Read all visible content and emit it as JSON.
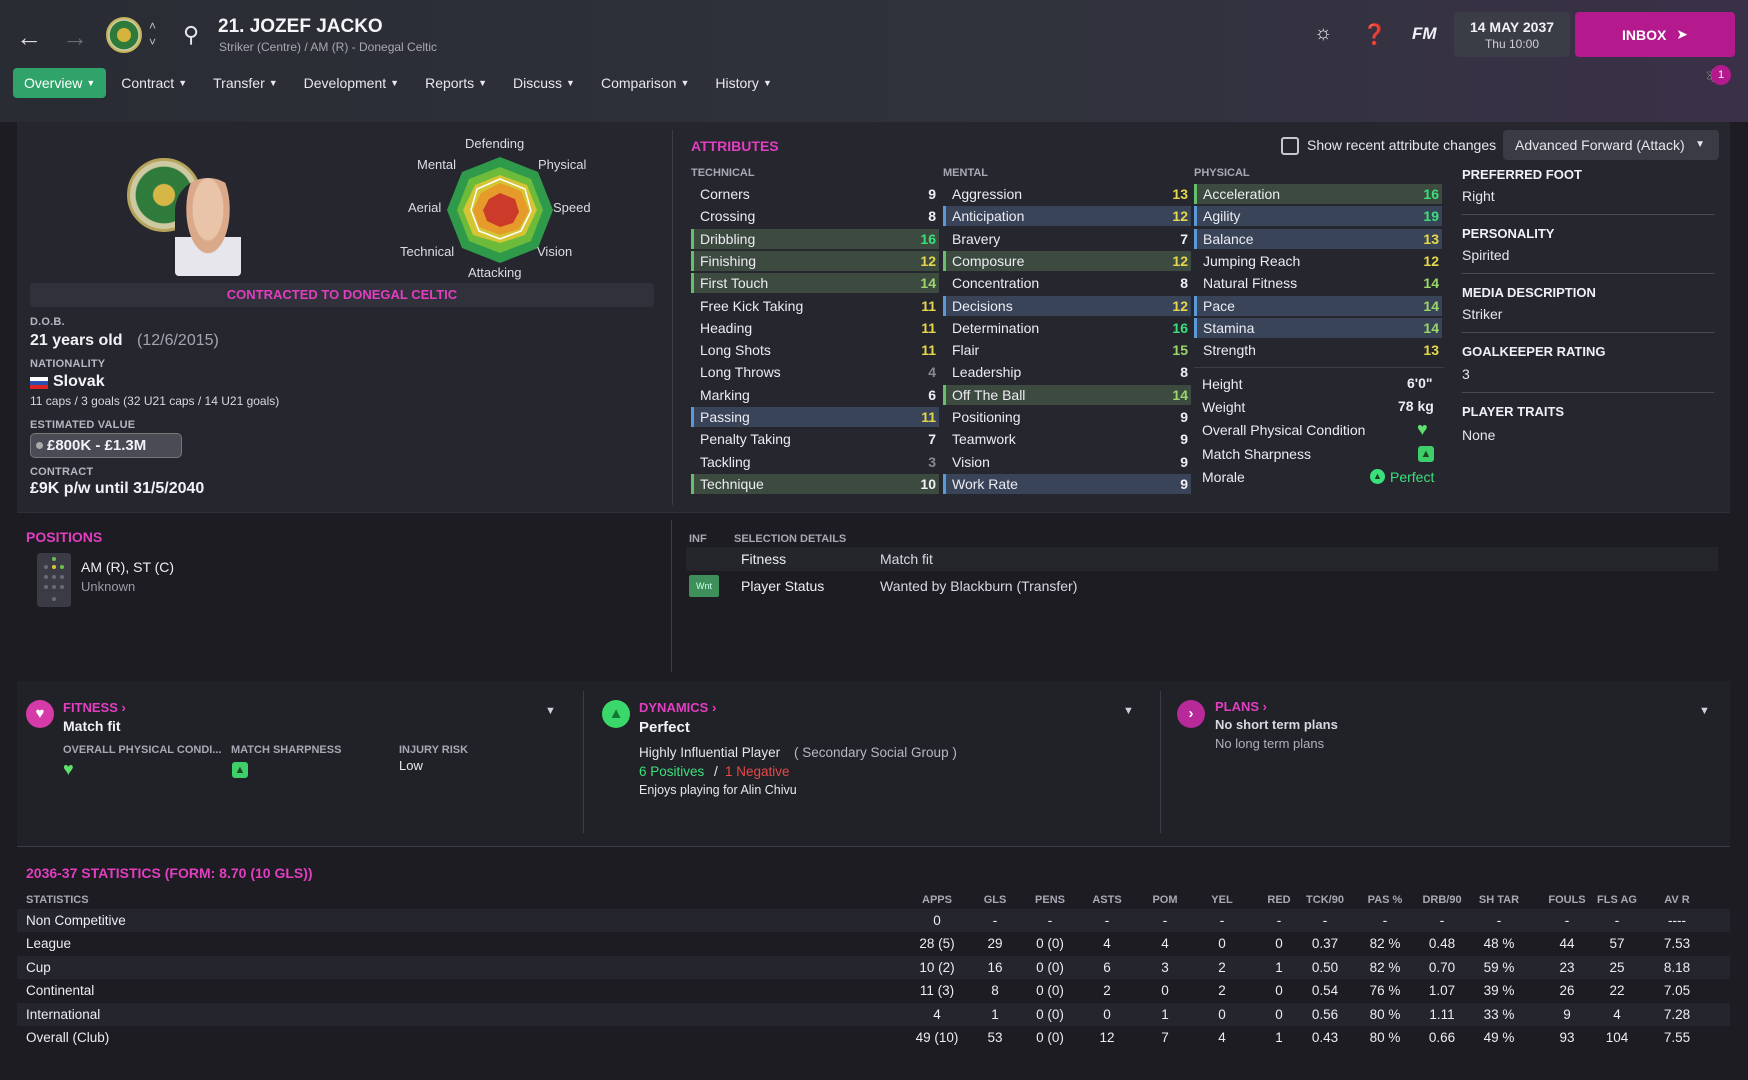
{
  "header": {
    "player_title": "21. JOZEF JACKO",
    "player_subtitle": "Striker (Centre) / AM (R) - Donegal Celtic",
    "fm_label": "FM",
    "date": "14 MAY 2037",
    "time": "Thu 10:00",
    "inbox_label": "INBOX",
    "notification_count": "1"
  },
  "menu": [
    {
      "label": "Overview"
    },
    {
      "label": "Contract"
    },
    {
      "label": "Transfer"
    },
    {
      "label": "Development"
    },
    {
      "label": "Reports"
    },
    {
      "label": "Discuss"
    },
    {
      "label": "Comparison"
    },
    {
      "label": "History"
    }
  ],
  "radar": {
    "labels": [
      "Defending",
      "Physical",
      "Speed",
      "Vision",
      "Attacking",
      "Technical",
      "Aerial",
      "Mental"
    ]
  },
  "profile": {
    "contracted": "CONTRACTED TO DONEGAL CELTIC",
    "dob_label": "D.O.B.",
    "age": "21 years old",
    "dob": "(12/6/2015)",
    "nationality_label": "NATIONALITY",
    "nationality": "Slovak",
    "caps": "11 caps / 3 goals (32 U21 caps / 14 U21 goals)",
    "value_label": "ESTIMATED VALUE",
    "value": "£800K - £1.3M",
    "contract_label": "CONTRACT",
    "contract": "£9K p/w until 31/5/2040"
  },
  "attributes": {
    "title": "ATTRIBUTES",
    "show_changes_label": "Show recent attribute changes",
    "role": "Advanced Forward (Attack)",
    "technical_head": "TECHNICAL",
    "mental_head": "MENTAL",
    "physical_head": "PHYSICAL",
    "technical": [
      {
        "name": "Corners",
        "value": "9",
        "hl": ""
      },
      {
        "name": "Crossing",
        "value": "8",
        "hl": ""
      },
      {
        "name": "Dribbling",
        "value": "16",
        "hl": "green"
      },
      {
        "name": "Finishing",
        "value": "12",
        "hl": "green"
      },
      {
        "name": "First Touch",
        "value": "14",
        "hl": "green"
      },
      {
        "name": "Free Kick Taking",
        "value": "11",
        "hl": ""
      },
      {
        "name": "Heading",
        "value": "11",
        "hl": ""
      },
      {
        "name": "Long Shots",
        "value": "11",
        "hl": ""
      },
      {
        "name": "Long Throws",
        "value": "4",
        "hl": ""
      },
      {
        "name": "Marking",
        "value": "6",
        "hl": ""
      },
      {
        "name": "Passing",
        "value": "11",
        "hl": "blue"
      },
      {
        "name": "Penalty Taking",
        "value": "7",
        "hl": ""
      },
      {
        "name": "Tackling",
        "value": "3",
        "hl": ""
      },
      {
        "name": "Technique",
        "value": "10",
        "hl": "green"
      }
    ],
    "mental": [
      {
        "name": "Aggression",
        "value": "13",
        "hl": ""
      },
      {
        "name": "Anticipation",
        "value": "12",
        "hl": "blue"
      },
      {
        "name": "Bravery",
        "value": "7",
        "hl": ""
      },
      {
        "name": "Composure",
        "value": "12",
        "hl": "green"
      },
      {
        "name": "Concentration",
        "value": "8",
        "hl": ""
      },
      {
        "name": "Decisions",
        "value": "12",
        "hl": "blue"
      },
      {
        "name": "Determination",
        "value": "16",
        "hl": ""
      },
      {
        "name": "Flair",
        "value": "15",
        "hl": ""
      },
      {
        "name": "Leadership",
        "value": "8",
        "hl": ""
      },
      {
        "name": "Off The Ball",
        "value": "14",
        "hl": "green"
      },
      {
        "name": "Positioning",
        "value": "9",
        "hl": ""
      },
      {
        "name": "Teamwork",
        "value": "9",
        "hl": ""
      },
      {
        "name": "Vision",
        "value": "9",
        "hl": ""
      },
      {
        "name": "Work Rate",
        "value": "9",
        "hl": "blue"
      }
    ],
    "physical": [
      {
        "name": "Acceleration",
        "value": "16",
        "hl": "green"
      },
      {
        "name": "Agility",
        "value": "19",
        "hl": "blue"
      },
      {
        "name": "Balance",
        "value": "13",
        "hl": "blue"
      },
      {
        "name": "Jumping Reach",
        "value": "12",
        "hl": ""
      },
      {
        "name": "Natural Fitness",
        "value": "14",
        "hl": ""
      },
      {
        "name": "Pace",
        "value": "14",
        "hl": "blue"
      },
      {
        "name": "Stamina",
        "value": "14",
        "hl": "blue"
      },
      {
        "name": "Strength",
        "value": "13",
        "hl": ""
      }
    ],
    "height_label": "Height",
    "height": "6'0\"",
    "weight_label": "Weight",
    "weight": "78 kg",
    "condition_label": "Overall Physical Condition",
    "sharpness_label": "Match Sharpness",
    "morale_label": "Morale",
    "morale": "Perfect"
  },
  "info": {
    "foot_label": "PREFERRED FOOT",
    "foot": "Right",
    "personality_label": "PERSONALITY",
    "personality": "Spirited",
    "media_label": "MEDIA DESCRIPTION",
    "media": "Striker",
    "gk_label": "GOALKEEPER RATING",
    "gk": "3",
    "traits_label": "PLAYER TRAITS",
    "traits": "None"
  },
  "positions": {
    "title": "POSITIONS",
    "positions": "AM (R), ST (C)",
    "familiarity": "Unknown"
  },
  "selection": {
    "inf_head": "INF",
    "details_head": "SELECTION DETAILS",
    "fitness_label": "Fitness",
    "fitness_value": "Match fit",
    "wnt_badge": "Wnt",
    "status_label": "Player Status",
    "status_value": "Wanted by Blackburn (Transfer)"
  },
  "fitness_panel": {
    "title": "FITNESS",
    "status": "Match fit",
    "condition_label": "OVERALL PHYSICAL CONDI...",
    "sharpness_label": "MATCH SHARPNESS",
    "injury_label": "INJURY RISK",
    "injury_value": "Low"
  },
  "dynamics_panel": {
    "title": "DYNAMICS",
    "status": "Perfect",
    "influence": "Highly Influential Player",
    "group": "( Secondary Social Group )",
    "positives": "6 Positives",
    "slash": "/",
    "negatives": "1 Negative",
    "enjoys": "Enjoys playing for Alin Chivu"
  },
  "plans_panel": {
    "title": "PLANS",
    "short": "No short term plans",
    "long": "No long term plans"
  },
  "stats": {
    "title": "2036-37 STATISTICS (FORM: 8.70 (10 GLS))",
    "headers": [
      "STATISTICS",
      "APPS",
      "GLS",
      "PENS",
      "ASTS",
      "POM",
      "YEL",
      "RED",
      "TCK/90",
      "PAS %",
      "DRB/90",
      "SH TAR",
      "FOULS",
      "FLS AG",
      "AV R"
    ],
    "rows": [
      [
        "Non Competitive",
        "0",
        "-",
        "-",
        "-",
        "-",
        "-",
        "-",
        "-",
        "-",
        "-",
        "-",
        "-",
        "-",
        "----"
      ],
      [
        "League",
        "28 (5)",
        "29",
        "0 (0)",
        "4",
        "4",
        "0",
        "0",
        "0.37",
        "82 %",
        "0.48",
        "48 %",
        "44",
        "57",
        "7.53"
      ],
      [
        "Cup",
        "10 (2)",
        "16",
        "0 (0)",
        "6",
        "3",
        "2",
        "1",
        "0.50",
        "82 %",
        "0.70",
        "59 %",
        "23",
        "25",
        "8.18"
      ],
      [
        "Continental",
        "11 (3)",
        "8",
        "0 (0)",
        "2",
        "0",
        "2",
        "0",
        "0.54",
        "76 %",
        "1.07",
        "39 %",
        "26",
        "22",
        "7.05"
      ],
      [
        "International",
        "4",
        "1",
        "0 (0)",
        "0",
        "1",
        "0",
        "0",
        "0.56",
        "80 %",
        "1.11",
        "33 %",
        "9",
        "4",
        "7.28"
      ],
      [
        "Overall (Club)",
        "49 (10)",
        "53",
        "0 (0)",
        "12",
        "7",
        "4",
        "1",
        "0.43",
        "80 %",
        "0.66",
        "49 %",
        "93",
        "104",
        "7.55"
      ]
    ]
  }
}
